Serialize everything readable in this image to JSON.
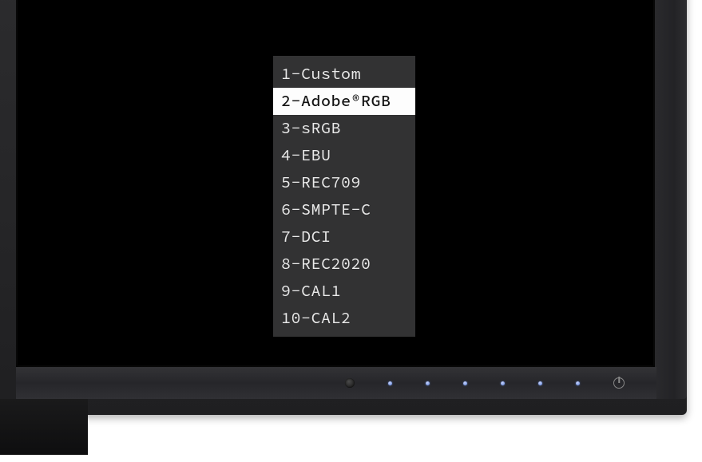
{
  "osd": {
    "items": [
      {
        "label": "1-Custom",
        "selected": false
      },
      {
        "label": "2-Adobe®RGB",
        "selected": true
      },
      {
        "label": "3-sRGB",
        "selected": false
      },
      {
        "label": "4-EBU",
        "selected": false
      },
      {
        "label": "5-REC709",
        "selected": false
      },
      {
        "label": "6-SMPTE-C",
        "selected": false
      },
      {
        "label": "7-DCI",
        "selected": false
      },
      {
        "label": "8-REC2020",
        "selected": false
      },
      {
        "label": "9-CAL1",
        "selected": false
      },
      {
        "label": "10-CAL2",
        "selected": false
      }
    ]
  },
  "buttons": {
    "count": 6
  }
}
